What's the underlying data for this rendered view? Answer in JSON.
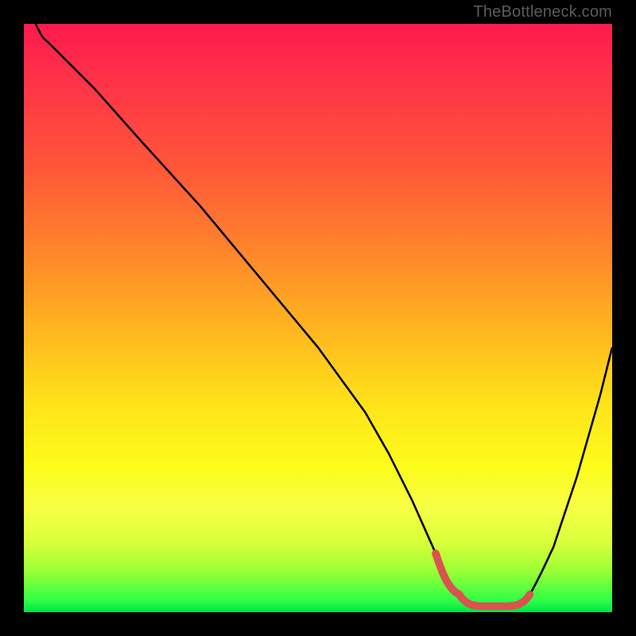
{
  "attribution": "TheBottleneck.com",
  "colors": {
    "frame": "#000000",
    "curve": "#000000",
    "highlight": "#d9534f",
    "gradient_top": "#ff1a4d",
    "gradient_mid": "#ffe41a",
    "gradient_bottom": "#00e04a"
  },
  "chart_data": {
    "type": "line",
    "title": "",
    "xlabel": "",
    "ylabel": "",
    "xlim": [
      0,
      100
    ],
    "ylim": [
      0,
      100
    ],
    "grid": false,
    "legend": false,
    "series": [
      {
        "name": "bottleneck-curve",
        "x": [
          2,
          4,
          8,
          12,
          20,
          30,
          40,
          50,
          58,
          62,
          66,
          70,
          74,
          78,
          82,
          86,
          90,
          94,
          98,
          100
        ],
        "y": [
          100,
          97,
          93,
          89,
          80,
          69,
          57,
          45,
          34,
          27,
          19,
          10,
          3,
          1,
          1,
          3,
          11,
          23,
          37,
          45
        ]
      }
    ],
    "annotations": [
      {
        "name": "optimal-range-highlight",
        "x_start": 70,
        "x_end": 85,
        "y": 1
      }
    ]
  }
}
